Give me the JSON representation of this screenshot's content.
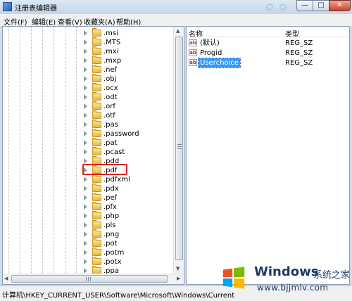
{
  "window": {
    "title": "注册表编辑器",
    "minimize": "—",
    "maximize": "□",
    "close": "✕"
  },
  "menu": [
    "文件(F)",
    "编辑(E)",
    "查看(V)",
    "收藏夹(A)",
    "帮助(H)"
  ],
  "tree": {
    "items": [
      ".msi",
      ".MTS",
      ".mxi",
      ".mxp",
      ".nef",
      ".obj",
      ".ocx",
      ".odt",
      ".orf",
      ".otf",
      ".pas",
      ".password",
      ".pat",
      ".pcast",
      ".pdd",
      ".pdf",
      ".pdfxml",
      ".pdx",
      ".pef",
      ".pfx",
      ".php",
      ".pls",
      ".png",
      ".pot",
      ".potm",
      ".potx",
      ".ppa"
    ],
    "highlighted_item": ".pdf",
    "hscroll_left": "◀",
    "hscroll_right": "▶",
    "vscroll_up": "▲",
    "vscroll_down": "▼"
  },
  "values": {
    "col_name": "名称",
    "col_type": "类型",
    "rows": [
      {
        "icon": "ab",
        "name": "(默认)",
        "type": "REG_SZ",
        "selected": false
      },
      {
        "icon": "ab",
        "name": "Progid",
        "type": "REG_SZ",
        "selected": false
      },
      {
        "icon": "ab",
        "name": "Userchoice",
        "type": "REG_SZ",
        "selected": true
      }
    ]
  },
  "status": {
    "path": "计算机\\HKEY_CURRENT_USER\\Software\\Microsoft\\Windows\\CurrentVe"
  },
  "watermark": {
    "brand": "Windows",
    "cn": "系统之家",
    "url": "www.bjjmlv.com"
  },
  "colors": {
    "selection": "#3399ff",
    "highlight_box": "#e02020",
    "folder": "#e5b744"
  }
}
